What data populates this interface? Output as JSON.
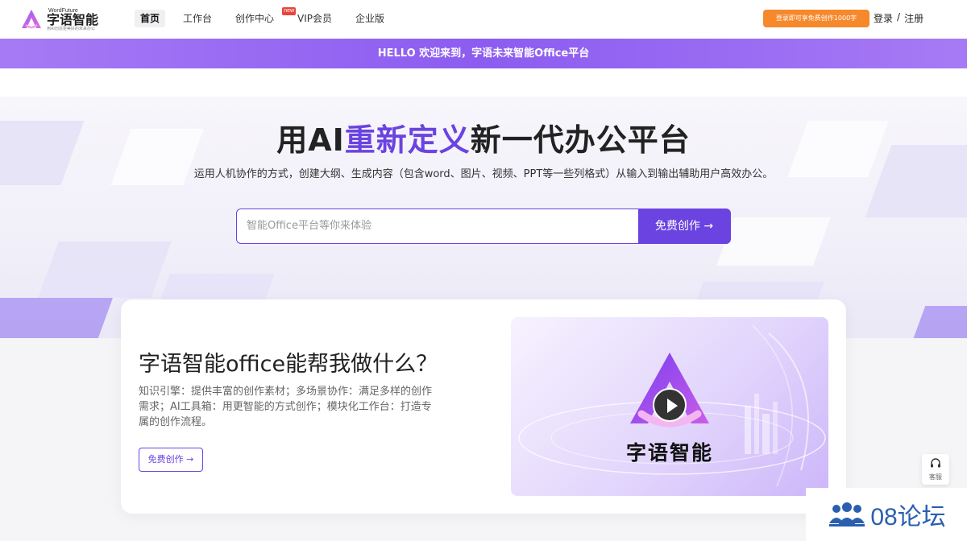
{
  "header": {
    "logo": {
      "small": "WordFuture",
      "main": "字语智能",
      "tagline": "用AI创造更美好的未来办公"
    },
    "nav": [
      {
        "label": "首页",
        "active": true
      },
      {
        "label": "工作台"
      },
      {
        "label": "创作中心",
        "badge": "new"
      },
      {
        "label": "VIP会员"
      },
      {
        "label": "企业版"
      }
    ],
    "promo_label": "登录即可享免费创作1000字",
    "login": "登录",
    "separator": "/",
    "register": "注册"
  },
  "banner": {
    "text": "HELLO 欢迎来到，字语未来智能Office平台"
  },
  "hero": {
    "title_pre": "用AI",
    "title_highlight": "重新定义",
    "title_post": "新一代办公平台",
    "subtitle": "运用人机协作的方式，创建大纲、生成内容（包含word、图片、视频、PPT等一些列格式）从输入到输出辅助用户高效办公。",
    "search_placeholder": "智能Office平台等你来体验",
    "search_button": "免费创作 →"
  },
  "feature": {
    "title": "字语智能office能帮我做什么？",
    "description": "知识引擎：提供丰富的创作素材；多场景协作：满足多样的创作需求；AI工具箱：用更智能的方式创作；模块化工作台：打造专属的创作流程。",
    "button": "免费创作 →",
    "video_brand": "字语智能"
  },
  "widgets": {
    "service_label": "客服",
    "watermark": "08论坛"
  },
  "colors": {
    "accent": "#6b43e0",
    "banner": "#9a6cf2",
    "promo": "#f5892b",
    "badge": "#e8453c"
  }
}
